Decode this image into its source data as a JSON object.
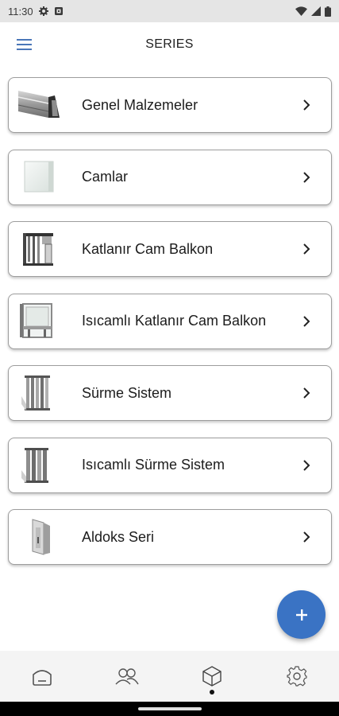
{
  "status": {
    "time": "11:30"
  },
  "header": {
    "title": "SERIES"
  },
  "series": [
    {
      "label": "Genel Malzemeler",
      "thumb": "aluminum-profile-thumbnail"
    },
    {
      "label": "Camlar",
      "thumb": "glass-panel-thumbnail"
    },
    {
      "label": "Katlanır Cam Balkon",
      "thumb": "folding-glass-balcony-thumbnail"
    },
    {
      "label": "Isıcamlı Katlanır Cam Balkon",
      "thumb": "insulated-folding-balcony-thumbnail"
    },
    {
      "label": "Sürme Sistem",
      "thumb": "sliding-system-thumbnail"
    },
    {
      "label": "Isıcamlı Sürme Sistem",
      "thumb": "insulated-sliding-system-thumbnail"
    },
    {
      "label": "Aldoks Seri",
      "thumb": "aldoks-profile-thumbnail"
    }
  ],
  "fab": {
    "icon": "plus-icon"
  },
  "nav": {
    "items": [
      {
        "icon": "home-icon"
      },
      {
        "icon": "users-icon"
      },
      {
        "icon": "cube-icon",
        "active": true
      },
      {
        "icon": "settings-icon"
      }
    ]
  },
  "colors": {
    "accent": "#3a73c4",
    "menu": "#4a76b8"
  }
}
